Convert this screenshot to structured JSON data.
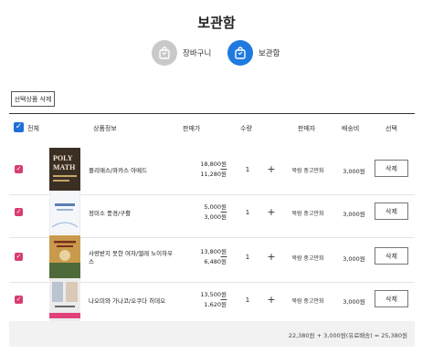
{
  "page": {
    "title": "보관함"
  },
  "steps": [
    {
      "label": "장바구니",
      "icon": "bag-icon"
    },
    {
      "label": "보관함",
      "icon": "bag-icon"
    }
  ],
  "actions": {
    "delete_selected": "선택상품 삭제"
  },
  "table": {
    "headers": {
      "all": "전체",
      "product": "상품정보",
      "price": "판매가",
      "qty": "수량",
      "seller": "판매자",
      "shipping": "배송비",
      "select": "선택"
    },
    "rows": [
      {
        "name": "폴리매스/와카스 아메드",
        "list_price": "18,800원",
        "sale_price": "11,280원",
        "qty": "1",
        "seller": "북람 중고만화",
        "shipping": "3,000원",
        "delete": "삭제",
        "cover_title": "POLY MATH",
        "cover_color": "#3b2f24"
      },
      {
        "name": "정미소 풍경/구활",
        "list_price": "5,000원",
        "sale_price": "3,000원",
        "qty": "1",
        "seller": "북람 중고만화",
        "shipping": "3,000원",
        "delete": "삭제",
        "cover_title": "정미소 풍경",
        "cover_color": "#dfe8f3"
      },
      {
        "name": "사랑받지 못한 여자/엘레 노이하우스",
        "list_price": "13,800원",
        "sale_price": "6,480원",
        "qty": "1",
        "seller": "북람 중고만화",
        "shipping": "3,000원",
        "delete": "삭제",
        "cover_title": "사랑받지 못한 여자",
        "cover_color": "#c99a4b"
      },
      {
        "name": "나오미와 가나코/오쿠다 히데오",
        "list_price": "13,500원",
        "sale_price": "1,620원",
        "qty": "1",
        "seller": "북람 중고만화",
        "shipping": "3,000원",
        "delete": "삭제",
        "cover_title": "나오미와 가나코",
        "cover_color": "#e9e9e9"
      }
    ]
  },
  "total": {
    "text": "22,380원 + 3,000원(유료배송) = 25,380원"
  },
  "colors": {
    "accent": "#1f7ae0",
    "checkbox": "#d83c72",
    "step_inactive": "#c9c9c9"
  }
}
